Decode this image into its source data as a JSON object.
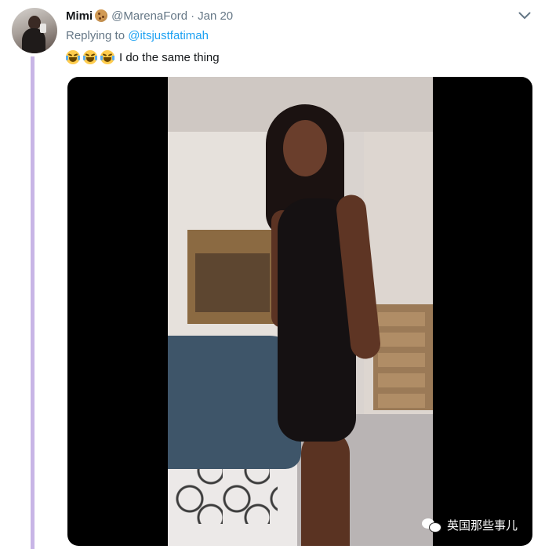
{
  "tweet": {
    "author_name": "Mimi",
    "author_name_emoji": "cookie-emoji",
    "handle": "@MarenaFord",
    "separator": "·",
    "date": "Jan 20",
    "reply_prefix": "Replying to",
    "reply_to": "@itsjustfatimah",
    "text": "I do the same thing",
    "text_emojis": [
      "face-with-tears-of-joy",
      "face-with-tears-of-joy",
      "face-with-tears-of-joy"
    ],
    "menu_icon": "chevron-down-icon"
  },
  "media": {
    "type": "video-frame",
    "watermark_text": "英国那些事儿",
    "watermark_icon": "wechat-icon"
  },
  "colors": {
    "thread_line": "#c8b5e6",
    "link": "#1da1f2",
    "muted": "#657786",
    "text": "#14171a"
  }
}
